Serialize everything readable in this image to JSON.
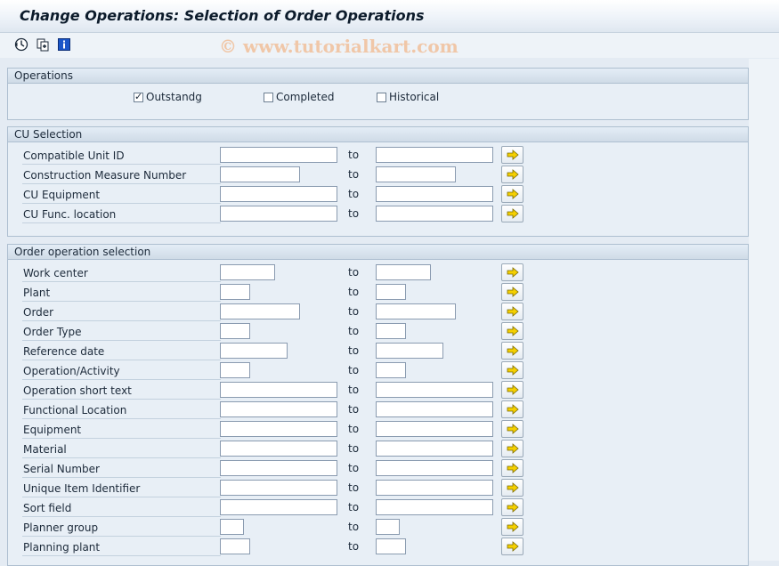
{
  "window": {
    "title": "Change Operations: Selection of Order Operations"
  },
  "toolbar": {
    "icons": [
      "execute-icon",
      "get-variant-icon",
      "information-icon"
    ]
  },
  "watermark": "© www.tutorialkart.com",
  "operations": {
    "title": "Operations",
    "checkboxes": [
      {
        "label": "Outstandg",
        "checked": true
      },
      {
        "label": "Completed",
        "checked": false
      },
      {
        "label": "Historical",
        "checked": false
      }
    ]
  },
  "cu_selection": {
    "title": "CU Selection",
    "to_label": "to",
    "rows": [
      {
        "label": "Compatible Unit ID",
        "from": "",
        "to": ""
      },
      {
        "label": "Construction Measure Number",
        "from": "",
        "to": ""
      },
      {
        "label": "CU Equipment",
        "from": "",
        "to": ""
      },
      {
        "label": "CU Func. location",
        "from": "",
        "to": ""
      }
    ]
  },
  "order_op_selection": {
    "title": "Order operation selection",
    "to_label": "to",
    "rows": [
      {
        "label": "Work center",
        "from": "",
        "to": ""
      },
      {
        "label": "Plant",
        "from": "",
        "to": ""
      },
      {
        "label": "Order",
        "from": "",
        "to": ""
      },
      {
        "label": "Order Type",
        "from": "",
        "to": ""
      },
      {
        "label": "Reference date",
        "from": "",
        "to": ""
      },
      {
        "label": "Operation/Activity",
        "from": "",
        "to": ""
      },
      {
        "label": "Operation short text",
        "from": "",
        "to": ""
      },
      {
        "label": "Functional Location",
        "from": "",
        "to": ""
      },
      {
        "label": "Equipment",
        "from": "",
        "to": ""
      },
      {
        "label": "Material",
        "from": "",
        "to": ""
      },
      {
        "label": "Serial Number",
        "from": "",
        "to": ""
      },
      {
        "label": "Unique Item Identifier",
        "from": "",
        "to": ""
      },
      {
        "label": "Sort field",
        "from": "",
        "to": ""
      },
      {
        "label": "Planner group",
        "from": "",
        "to": ""
      },
      {
        "label": "Planning plant",
        "from": "",
        "to": ""
      }
    ]
  },
  "colors": {
    "background": "#e4ebf3",
    "group_header": "#cfdbe7",
    "watermark": "#f0c7a8",
    "arrow": "#f5d000"
  }
}
